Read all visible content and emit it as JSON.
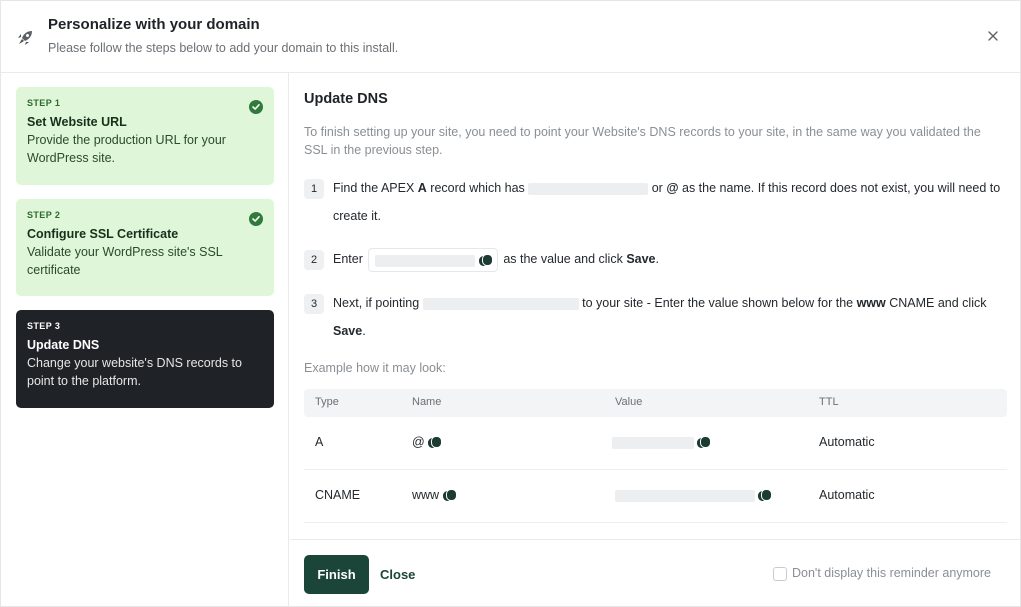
{
  "header": {
    "title": "Personalize with your domain",
    "subtitle": "Please follow the steps below to add your domain to this install.",
    "rocket_icon": "rocket-icon",
    "close_icon": "close-icon"
  },
  "steps": [
    {
      "number": "STEP 1",
      "name": "Set Website URL",
      "description": "Provide the production URL for your WordPress site.",
      "status": "completed"
    },
    {
      "number": "STEP 2",
      "name": "Configure SSL Certificate",
      "description": "Validate your WordPress site's SSL certificate",
      "status": "completed"
    },
    {
      "number": "STEP 3",
      "name": "Update DNS",
      "description": "Change your website's DNS records to point to the platform.",
      "status": "active"
    }
  ],
  "main": {
    "title": "Update DNS",
    "intro": "To finish setting up your site, you need to point your Website's DNS records to your site, in the same way you validated the SSL in the previous step.",
    "instructions": [
      {
        "number": "1",
        "p1": "Find the APEX ",
        "b1": "A",
        "p2": " record which has ",
        "p3": " or ",
        "b2": "@",
        "p4": " as the name. If this record does not exist, you will need to create it."
      },
      {
        "number": "2",
        "p1": "Enter ",
        "p2": " as the value and click ",
        "b1": "Save",
        "p3": "."
      },
      {
        "number": "3",
        "p1": "Next, if pointing ",
        "p2": " to your site - Enter the value shown below for the ",
        "b1": "www",
        "p3": " CNAME and click ",
        "b2": "Save",
        "p4": "."
      }
    ],
    "example_label": "Example how it may look:",
    "table": {
      "columns": [
        "Type",
        "Name",
        "Value",
        "TTL"
      ],
      "rows": [
        {
          "type": "A",
          "name": "@",
          "ttl": "Automatic"
        },
        {
          "type": "CNAME",
          "name": "www",
          "ttl": "Automatic"
        }
      ]
    }
  },
  "footer": {
    "finish_label": "Finish",
    "close_label": "Close",
    "reminder_label": "Don't display this reminder anymore"
  },
  "colors": {
    "primary": "#1b4538",
    "step_done_bg": "#e0f6d9",
    "step_active_bg": "#1f2226",
    "check_green": "#2f7a3c"
  }
}
